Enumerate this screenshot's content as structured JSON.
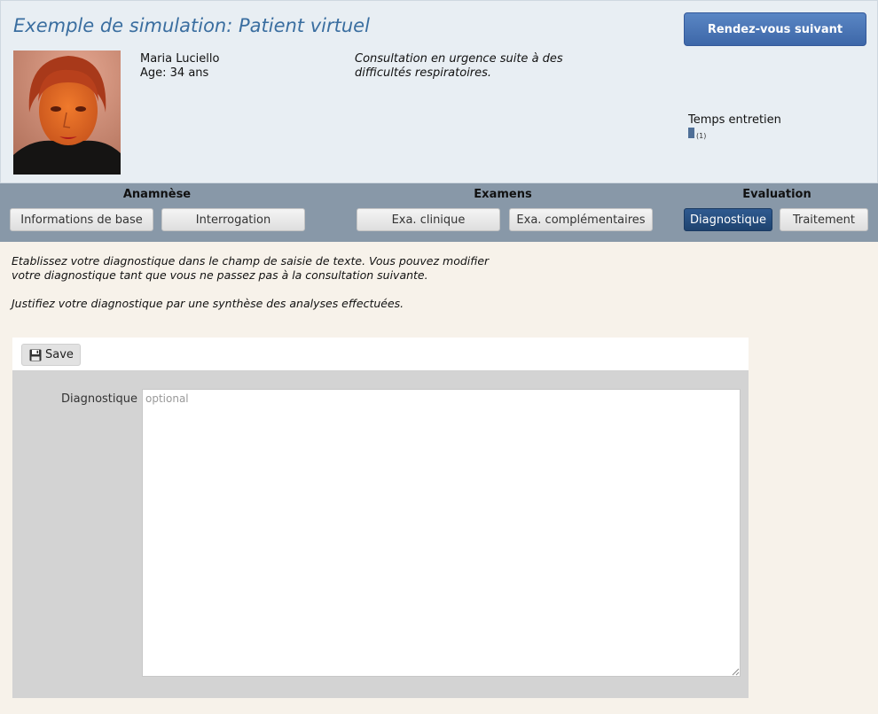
{
  "header": {
    "title": "Exemple de simulation: Patient virtuel",
    "next_button": "Rendez-vous suivant",
    "patient": {
      "name": "Maria Luciello",
      "age": "Age: 34 ans"
    },
    "consultation_reason": "Consultation en urgence suite à des difficultés respiratoires.",
    "time": {
      "label": "Temps entretien",
      "count": "(1)"
    }
  },
  "nav": {
    "groups": [
      {
        "title": "Anamnèse",
        "tabs": [
          "Informations de base",
          "Interrogation"
        ]
      },
      {
        "title": "Examens",
        "tabs": [
          "Exa. clinique",
          "Exa. complémentaires"
        ]
      },
      {
        "title": "Evaluation",
        "tabs": [
          "Diagnostique",
          "Traitement"
        ]
      }
    ],
    "active_tab": "Diagnostique"
  },
  "content": {
    "instructions": [
      "Etablissez votre diagnostique dans le champ de saisie de texte. Vous pouvez modifier votre diagnostique tant que vous ne passez pas à la consultation suivante.",
      "Justifiez votre diagnostique par une synthèse des analyses effectuées."
    ],
    "toolbar": {
      "save_label": "Save"
    },
    "form": {
      "diagnostic_label": "Diagnostique",
      "diagnostic_placeholder": "optional",
      "diagnostic_value": ""
    }
  },
  "colors": {
    "header_bg": "#e8eef3",
    "title": "#3a6ea0",
    "nav_bg": "#8898a8",
    "active_tab": "#2f5a90",
    "primary_button": "#4a76b6",
    "page_bg": "#f7f2ea"
  },
  "icons": {
    "save": "floppy-disk-icon"
  }
}
